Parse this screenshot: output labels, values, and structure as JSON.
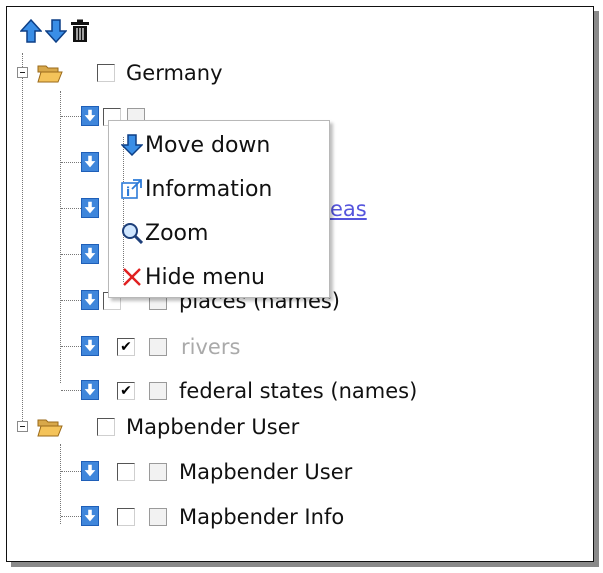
{
  "toolbar": {
    "icons": [
      "arrow-up-icon",
      "arrow-down-icon",
      "trash-icon"
    ]
  },
  "tree": {
    "groups": [
      {
        "label": "Germany",
        "layers": [
          {
            "label": "",
            "checked": false,
            "style": "normal"
          },
          {
            "label": "",
            "checked": false,
            "style": "normal"
          },
          {
            "label": "eas",
            "checked": false,
            "style": "link"
          },
          {
            "label": "",
            "checked": false,
            "style": "normal"
          },
          {
            "label": "places (names)",
            "checked": false,
            "style": "normal"
          },
          {
            "label": "rivers",
            "checked": true,
            "style": "grey"
          },
          {
            "label": "federal states (names)",
            "checked": true,
            "style": "normal"
          }
        ]
      },
      {
        "label": "Mapbender User",
        "layers": [
          {
            "label": "Mapbender User",
            "checked": false,
            "style": "normal"
          },
          {
            "label": "Mapbender Info",
            "checked": false,
            "style": "normal"
          }
        ]
      }
    ]
  },
  "context_menu": {
    "move_down": "Move down",
    "information": "Information",
    "zoom": "Zoom",
    "hide_menu": "Hide menu"
  },
  "checkmark": "✔"
}
